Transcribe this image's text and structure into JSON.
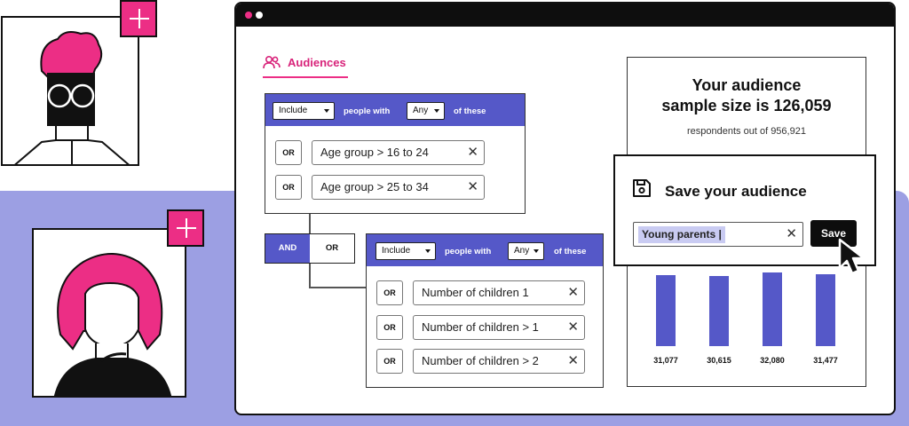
{
  "colors": {
    "accent": "#5558c8",
    "brand_pink": "#ec2e85",
    "band": "#9c9fe3"
  },
  "tab": {
    "icon": "users-icon",
    "label": "Audiences"
  },
  "rule1": {
    "include": "Include",
    "people_with": "people with",
    "any": "Any",
    "of_these": "of these",
    "conditions": [
      {
        "op": "OR",
        "text": "Age group > 16 to 24"
      },
      {
        "op": "OR",
        "text": "Age group > 25 to 34"
      }
    ]
  },
  "logic": {
    "and": "AND",
    "or": "OR"
  },
  "rule2": {
    "include": "Include",
    "people_with": "people with",
    "any": "Any",
    "of_these": "of these",
    "conditions": [
      {
        "op": "OR",
        "text": "Number of children 1"
      },
      {
        "op": "OR",
        "text": "Number of children > 1"
      },
      {
        "op": "OR",
        "text": "Number of children > 2"
      }
    ]
  },
  "stats": {
    "title_line1": "Your audience",
    "title_line2": "sample size is 126,059",
    "subtitle": "respondents out of 956,921"
  },
  "chart_data": {
    "type": "bar",
    "categories": [
      "",
      "",
      "",
      ""
    ],
    "values": [
      31077,
      30615,
      32080,
      31477
    ],
    "value_labels": [
      "31,077",
      "30,615",
      "32,080",
      "31,477"
    ],
    "ylim": [
      0,
      34000
    ],
    "grid": false
  },
  "save": {
    "icon": "floppy-disk-icon",
    "title": "Save your audience",
    "input_value": "Young parents |",
    "button_label": "Save"
  }
}
